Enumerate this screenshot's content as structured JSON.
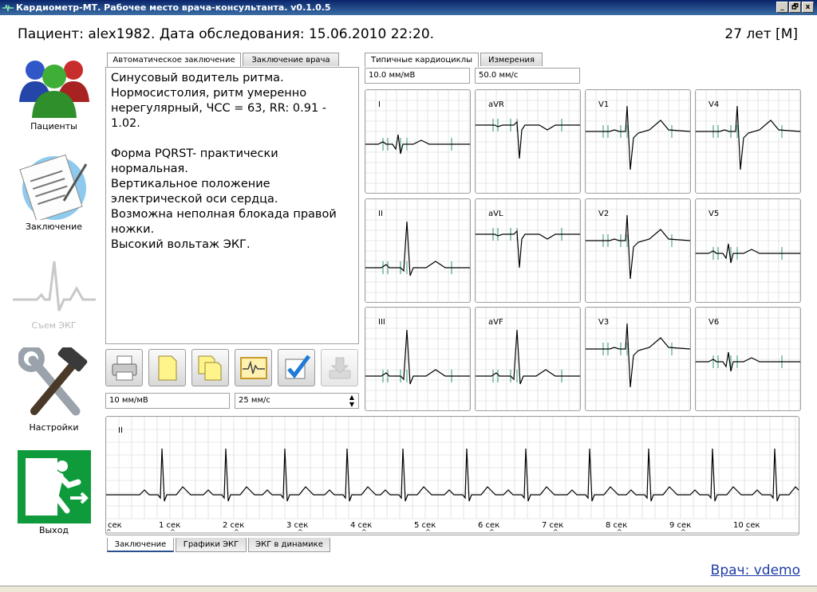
{
  "window": {
    "title": "Кардиометр-МТ. Рабочее место врача-консультанта. v0.1.0.5",
    "buttons": [
      "_",
      "🗗",
      "x"
    ]
  },
  "header": {
    "patient": "Пациент: alex1982.  Дата обследования: 15.06.2010 22:20.",
    "age": "27 лет [М]"
  },
  "nav": {
    "patients": "Пациенты",
    "conclusion": "Заключение",
    "ecg": "Съем ЭКГ",
    "settings": "Настройки",
    "exit": "Выход"
  },
  "conclusion_tabs": [
    "Автоматическое заключение",
    "Заключение врача"
  ],
  "conclusion_text": "Синусовый водитель ритма.\nНормосистолия, ритм умеренно нерегулярный, ЧСС = 63, RR: 0.91 - 1.02.\n\nФорма PQRST- практически нормальная.\nВертикальное положение электрической оси сердца.\nВозможна неполная блокада правой ножки.\nВысокий вольтаж ЭКГ.",
  "toolbar_icons": [
    "printer-icon",
    "new-document-icon",
    "copy-documents-icon",
    "ecg-report-icon",
    "checkbox-icon",
    "download-icon"
  ],
  "left_scale": {
    "amplitude": "10 мм/мВ",
    "speed": "25 мм/с"
  },
  "cycles_tabs": [
    "Типичные кардиоциклы",
    "Измерения"
  ],
  "cycles_scale": {
    "amplitude": "10.0 мм/мВ",
    "speed": "50.0 мм/с"
  },
  "leads": [
    "I",
    "aVR",
    "V1",
    "V4",
    "II",
    "aVL",
    "V2",
    "V5",
    "III",
    "aVF",
    "V3",
    "V6"
  ],
  "rhythm": {
    "lead": "II",
    "time_labels": [
      "сек",
      "1 сек",
      "2 сек",
      "3 сек",
      "4 сек",
      "5 сек",
      "6 сек",
      "7 сек",
      "8 сек",
      "9 сек",
      "10 сек"
    ]
  },
  "bottom_tabs": [
    "Заключение",
    "Графики ЭКГ",
    "ЭКГ в динамике"
  ],
  "doctor": "Врач: vdemo",
  "colors": {
    "grid": "#cfd5d0",
    "trace": "#000000",
    "marker": "#2f8f7a",
    "accent": "#2a4f8f"
  }
}
